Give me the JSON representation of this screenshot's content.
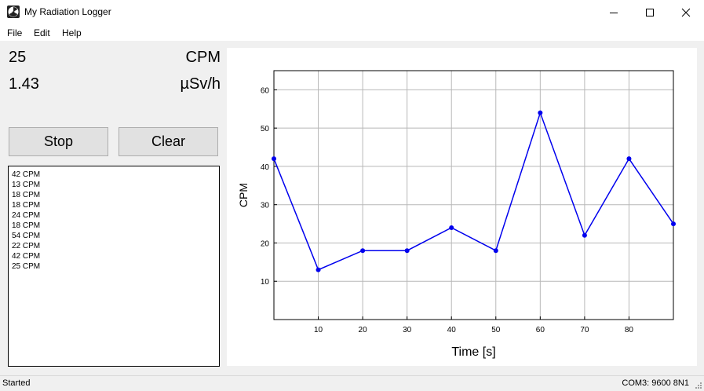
{
  "window": {
    "title": "My Radiation Logger",
    "icon": "radiation-icon",
    "controls": [
      "minimize-icon",
      "maximize-icon",
      "close-icon"
    ]
  },
  "menu": [
    "File",
    "Edit",
    "Help"
  ],
  "readouts": {
    "cpm_value": "25",
    "cpm_unit": "CPM",
    "dose_value": "1.43",
    "dose_unit": "µSv/h"
  },
  "buttons": {
    "stop": "Stop",
    "clear": "Clear"
  },
  "log": [
    "42 CPM",
    "13 CPM",
    "18 CPM",
    "18 CPM",
    "24 CPM",
    "18 CPM",
    "54 CPM",
    "22 CPM",
    "42 CPM",
    "25 CPM"
  ],
  "status": {
    "left": "Started",
    "right": "COM3: 9600 8N1"
  },
  "colors": {
    "series": "#0000ee",
    "grid": "#b8b8b8"
  },
  "chart_data": {
    "type": "line",
    "x": [
      0,
      10,
      20,
      30,
      40,
      50,
      60,
      70,
      80,
      90
    ],
    "series": [
      {
        "values": [
          42,
          13,
          18,
          18,
          24,
          18,
          54,
          22,
          42,
          25
        ]
      }
    ],
    "xlabel": "Time [s]",
    "ylabel": "CPM",
    "xlim": [
      0,
      90
    ],
    "ylim": [
      0,
      65
    ],
    "xticks": [
      10,
      20,
      30,
      40,
      50,
      60,
      70,
      80
    ],
    "yticks": [
      10,
      20,
      30,
      40,
      50,
      60
    ],
    "grid": true,
    "markers": true
  }
}
